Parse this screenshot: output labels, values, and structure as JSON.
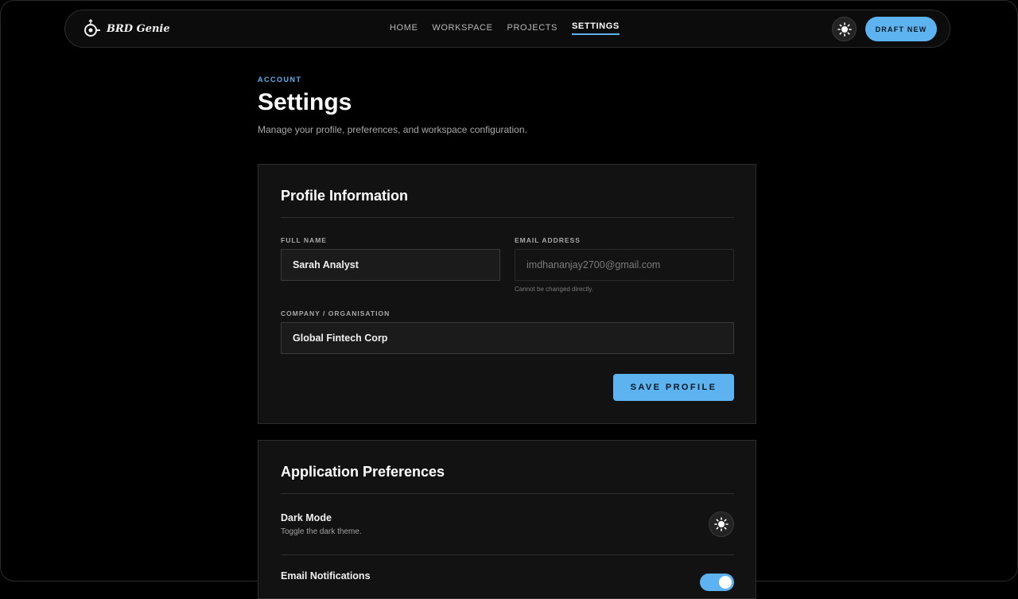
{
  "nav": {
    "brand": "BRD Genie",
    "links": [
      {
        "label": "HOME",
        "active": false
      },
      {
        "label": "WORKSPACE",
        "active": false
      },
      {
        "label": "PROJECTS",
        "active": false
      },
      {
        "label": "SETTINGS",
        "active": true
      }
    ],
    "theme_icon": "sun-icon",
    "draft_label": "DRAFT NEW"
  },
  "header": {
    "eyebrow": "ACCOUNT",
    "title": "Settings",
    "subtitle": "Manage your profile, preferences, and workspace configuration."
  },
  "profile": {
    "title": "Profile Information",
    "full_name_label": "FULL NAME",
    "full_name_value": "Sarah Analyst",
    "email_label": "EMAIL ADDRESS",
    "email_value": "imdhananjay2700@gmail.com",
    "email_hint": "Cannot be changed directly.",
    "company_label": "COMPANY / ORGANISATION",
    "company_value": "Global Fintech Corp",
    "save_label": "SAVE PROFILE"
  },
  "preferences": {
    "title": "Application Preferences",
    "dark_mode_label": "Dark Mode",
    "dark_mode_desc": "Toggle the dark theme.",
    "email_notif_label": "Email Notifications",
    "email_notif_on": true
  },
  "colors": {
    "accent": "#5cb3f0",
    "background": "#000000",
    "card": "#121212"
  }
}
